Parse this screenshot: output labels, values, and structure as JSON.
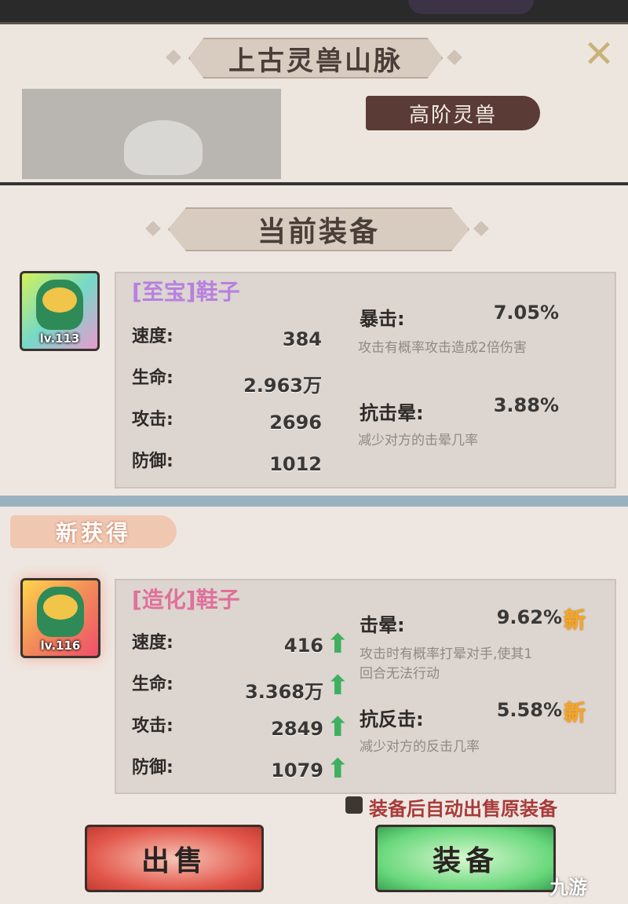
{
  "background_dialog": {
    "title": "上古灵兽山脉",
    "close_glyph": "✕",
    "tag": "高阶灵兽"
  },
  "panel": {
    "header": "当前装备",
    "current": {
      "name": "[至宝]鞋子",
      "level": "lv.113",
      "stats": [
        {
          "label": "速度:",
          "value": "384"
        },
        {
          "label": "生命:",
          "value": "2.963万"
        },
        {
          "label": "攻击:",
          "value": "2696"
        },
        {
          "label": "防御:",
          "value": "1012"
        }
      ],
      "attrs": [
        {
          "label": "暴击:",
          "value": "7.05%",
          "desc": "攻击有概率攻击造成2倍伤害"
        },
        {
          "label": "抗击晕:",
          "value": "3.88%",
          "desc": "减少对方的击晕几率"
        }
      ]
    },
    "new_badge": "新获得",
    "new": {
      "name": "[造化]鞋子",
      "level": "lv.116",
      "up_glyph": "⬆",
      "new_tag": "新",
      "stats": [
        {
          "label": "速度:",
          "value": "416"
        },
        {
          "label": "生命:",
          "value": "3.368万"
        },
        {
          "label": "攻击:",
          "value": "2849"
        },
        {
          "label": "防御:",
          "value": "1079"
        }
      ],
      "attrs": [
        {
          "label": "击晕:",
          "value": "9.62%",
          "desc1": "攻击时有概率打晕对手,使其1",
          "desc2": "回合无法行动"
        },
        {
          "label": "抗反击:",
          "value": "5.58%",
          "desc1": "减少对方的反击几率"
        }
      ]
    },
    "auto_sell_label": "装备后自动出售原装备",
    "sell_button": "出售",
    "equip_button": "装备",
    "watermark": "九游"
  },
  "colors": {
    "name_current": "#b780e0",
    "name_new": "#e0709a",
    "up_arrow": "#3eb060",
    "sell_button": "#e2564a",
    "equip_button": "#69d87c"
  }
}
